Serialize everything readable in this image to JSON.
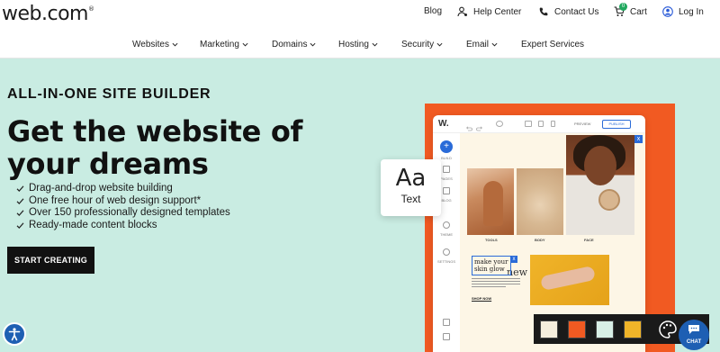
{
  "brand": {
    "logo_text": "web.com"
  },
  "utility_nav": {
    "blog": "Blog",
    "help": "Help Center",
    "contact": "Contact Us",
    "cart": "Cart",
    "cart_count": "0",
    "login": "Log In"
  },
  "main_nav": {
    "items": [
      {
        "label": "Websites",
        "dropdown": true
      },
      {
        "label": "Marketing",
        "dropdown": true
      },
      {
        "label": "Domains",
        "dropdown": true
      },
      {
        "label": "Hosting",
        "dropdown": true
      },
      {
        "label": "Security",
        "dropdown": true
      },
      {
        "label": "Email",
        "dropdown": true
      },
      {
        "label": "Expert Services",
        "dropdown": false
      }
    ]
  },
  "hero": {
    "eyebrow": "ALL-IN-ONE SITE BUILDER",
    "headline": "Get the website of your dreams",
    "features": [
      "Drag-and-drop website building",
      "One free hour of web design support*",
      "Over 150 professionally designed templates",
      "Ready-made content blocks"
    ],
    "cta_label": "START CREATING"
  },
  "builder_mockup": {
    "logo": "W.",
    "preview_label": "PREVIEW",
    "publish_label": "PUBLISH",
    "sidebar": [
      "BUILD",
      "PAGES",
      "BLOG",
      "THEME",
      "SETTINGS"
    ],
    "section_title": "new arrivals",
    "captions": [
      "TOOLS",
      "BODY",
      "FACE"
    ],
    "promo_heading": "make your skin glow",
    "shop_now": "SHOP NOW",
    "close_glyph": "x",
    "text_card": {
      "aa": "Aa",
      "label": "Text"
    },
    "swatches": [
      "#f6eedd",
      "#f15a22",
      "#d8efe6",
      "#f0b429"
    ]
  },
  "chat": {
    "label": "CHAT"
  },
  "colors": {
    "hero_bg": "#c9ece2",
    "accent_orange": "#f15a22",
    "accent_blue": "#2a6bd8",
    "cta_bg": "#111111"
  }
}
